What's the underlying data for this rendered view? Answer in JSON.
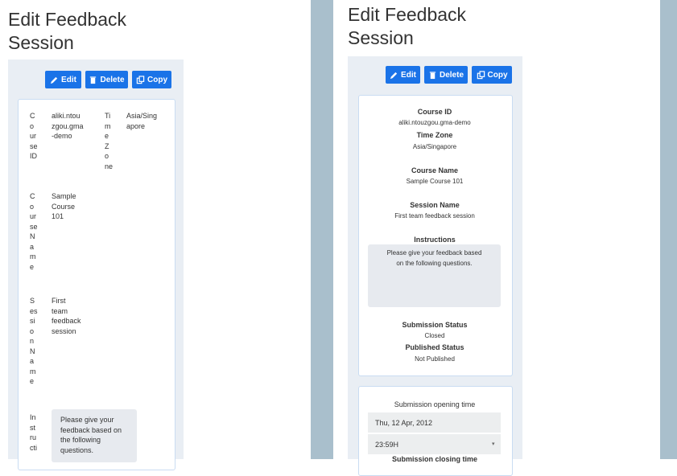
{
  "title_line1": "Edit Feedback",
  "title_line2": "Session",
  "buttons": {
    "edit": "Edit",
    "delete": "Delete",
    "copy": "Copy"
  },
  "left": {
    "course_id_label": "C\no\nur\nse\nID",
    "course_id_value": "aliki.ntou\nzgou.gma\n-demo",
    "tz_label": "Ti\nm\ne\nZ\no\nne",
    "tz_value": "Asia/Sing\napore",
    "course_name_label": "C\no\nur\nse\nN\na\nm\ne",
    "course_name_value": "Sample\nCourse\n101",
    "session_name_label": "S\nes\nsi\no\nn\nN\na\nm\ne",
    "session_name_value": "First\nteam\nfeedback\nsession",
    "instructions_label": "In\nst\nru\ncti",
    "instructions_value": "Please give your\nfeedback based on\nthe following\nquestions."
  },
  "right": {
    "course_id_label": "Course ID",
    "course_id_value": "aliki.ntouzgou.gma-demo",
    "tz_label": "Time Zone",
    "tz_value": "Asia/Singapore",
    "course_name_label": "Course Name",
    "course_name_value": "Sample Course 101",
    "session_name_label": "Session Name",
    "session_name_value": "First team feedback session",
    "instructions_label": "Instructions",
    "instructions_value": "Please give your feedback based\non the following questions.",
    "submission_status_label": "Submission Status",
    "submission_status_value": "Closed",
    "published_status_label": "Published Status",
    "published_status_value": "Not Published",
    "opening_time_label": "Submission opening time",
    "opening_date": "Thu, 12 Apr, 2012",
    "opening_time": "23:59H",
    "closing_time_label": "Submission closing time"
  },
  "colors": {
    "accent": "#1a73e8",
    "stripe": "#a9bfcc",
    "panel": "#e9eef4"
  }
}
